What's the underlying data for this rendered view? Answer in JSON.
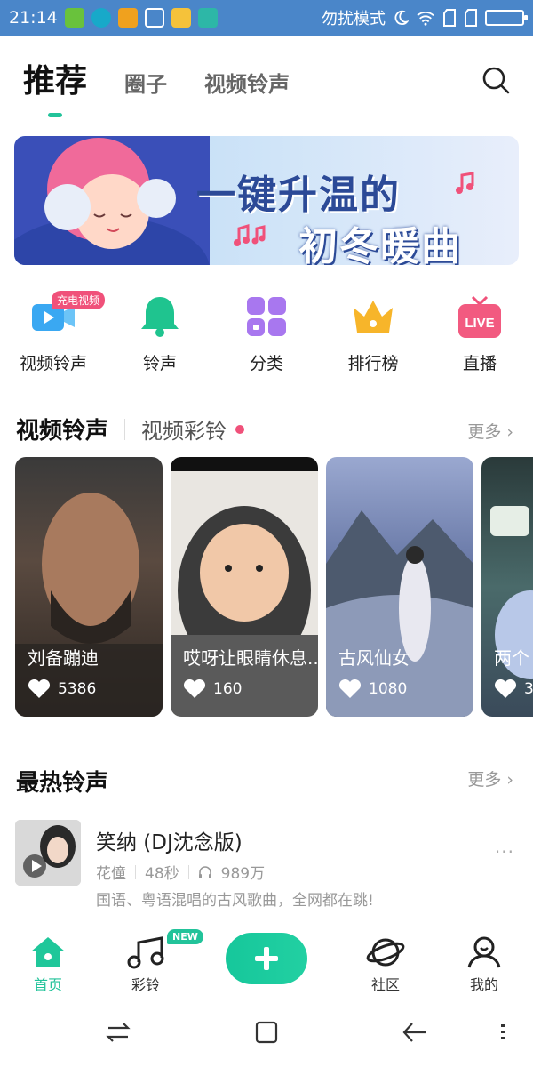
{
  "status_bar": {
    "time": "21:14",
    "mode_text": "勿扰模式"
  },
  "top_tabs": [
    "推荐",
    "圈子",
    "视频铃声"
  ],
  "banner": {
    "line1": "一键升温的",
    "line2": "初冬暖曲"
  },
  "quick_entries": [
    {
      "label": "视频铃声",
      "icon": "video-icon",
      "badge": "充电视频"
    },
    {
      "label": "铃声",
      "icon": "bell-icon"
    },
    {
      "label": "分类",
      "icon": "category-grid-icon"
    },
    {
      "label": "排行榜",
      "icon": "crown-icon"
    },
    {
      "label": "直播",
      "icon": "live-tv-icon",
      "icon_text": "LIVE"
    }
  ],
  "video_section": {
    "title": "视频铃声",
    "subtitle": "视频彩铃",
    "more": "更多 ›",
    "cards": [
      {
        "title": "刘备蹦迪",
        "likes": "5386"
      },
      {
        "title": "哎呀让眼睛休息...",
        "likes": "160"
      },
      {
        "title": "古风仙女",
        "likes": "1080"
      },
      {
        "title": "两个",
        "likes": "3"
      }
    ]
  },
  "hot_section": {
    "title": "最热铃声",
    "more": "更多 ›",
    "songs": [
      {
        "name": "笑纳 (DJ沈念版)",
        "artist": "花僮",
        "duration": "48秒",
        "plays": "989万",
        "desc": "国语、粤语混唱的古风歌曲，全网都在跳!",
        "options": "···"
      }
    ]
  },
  "bottom_nav": {
    "home": "首页",
    "ringtone": "彩铃",
    "new_badge": "NEW",
    "community": "社区",
    "mine": "我的"
  },
  "colors": {
    "accent": "#22c39a",
    "badge_pink": "#f0517a",
    "status_bar": "#4a86c9"
  }
}
